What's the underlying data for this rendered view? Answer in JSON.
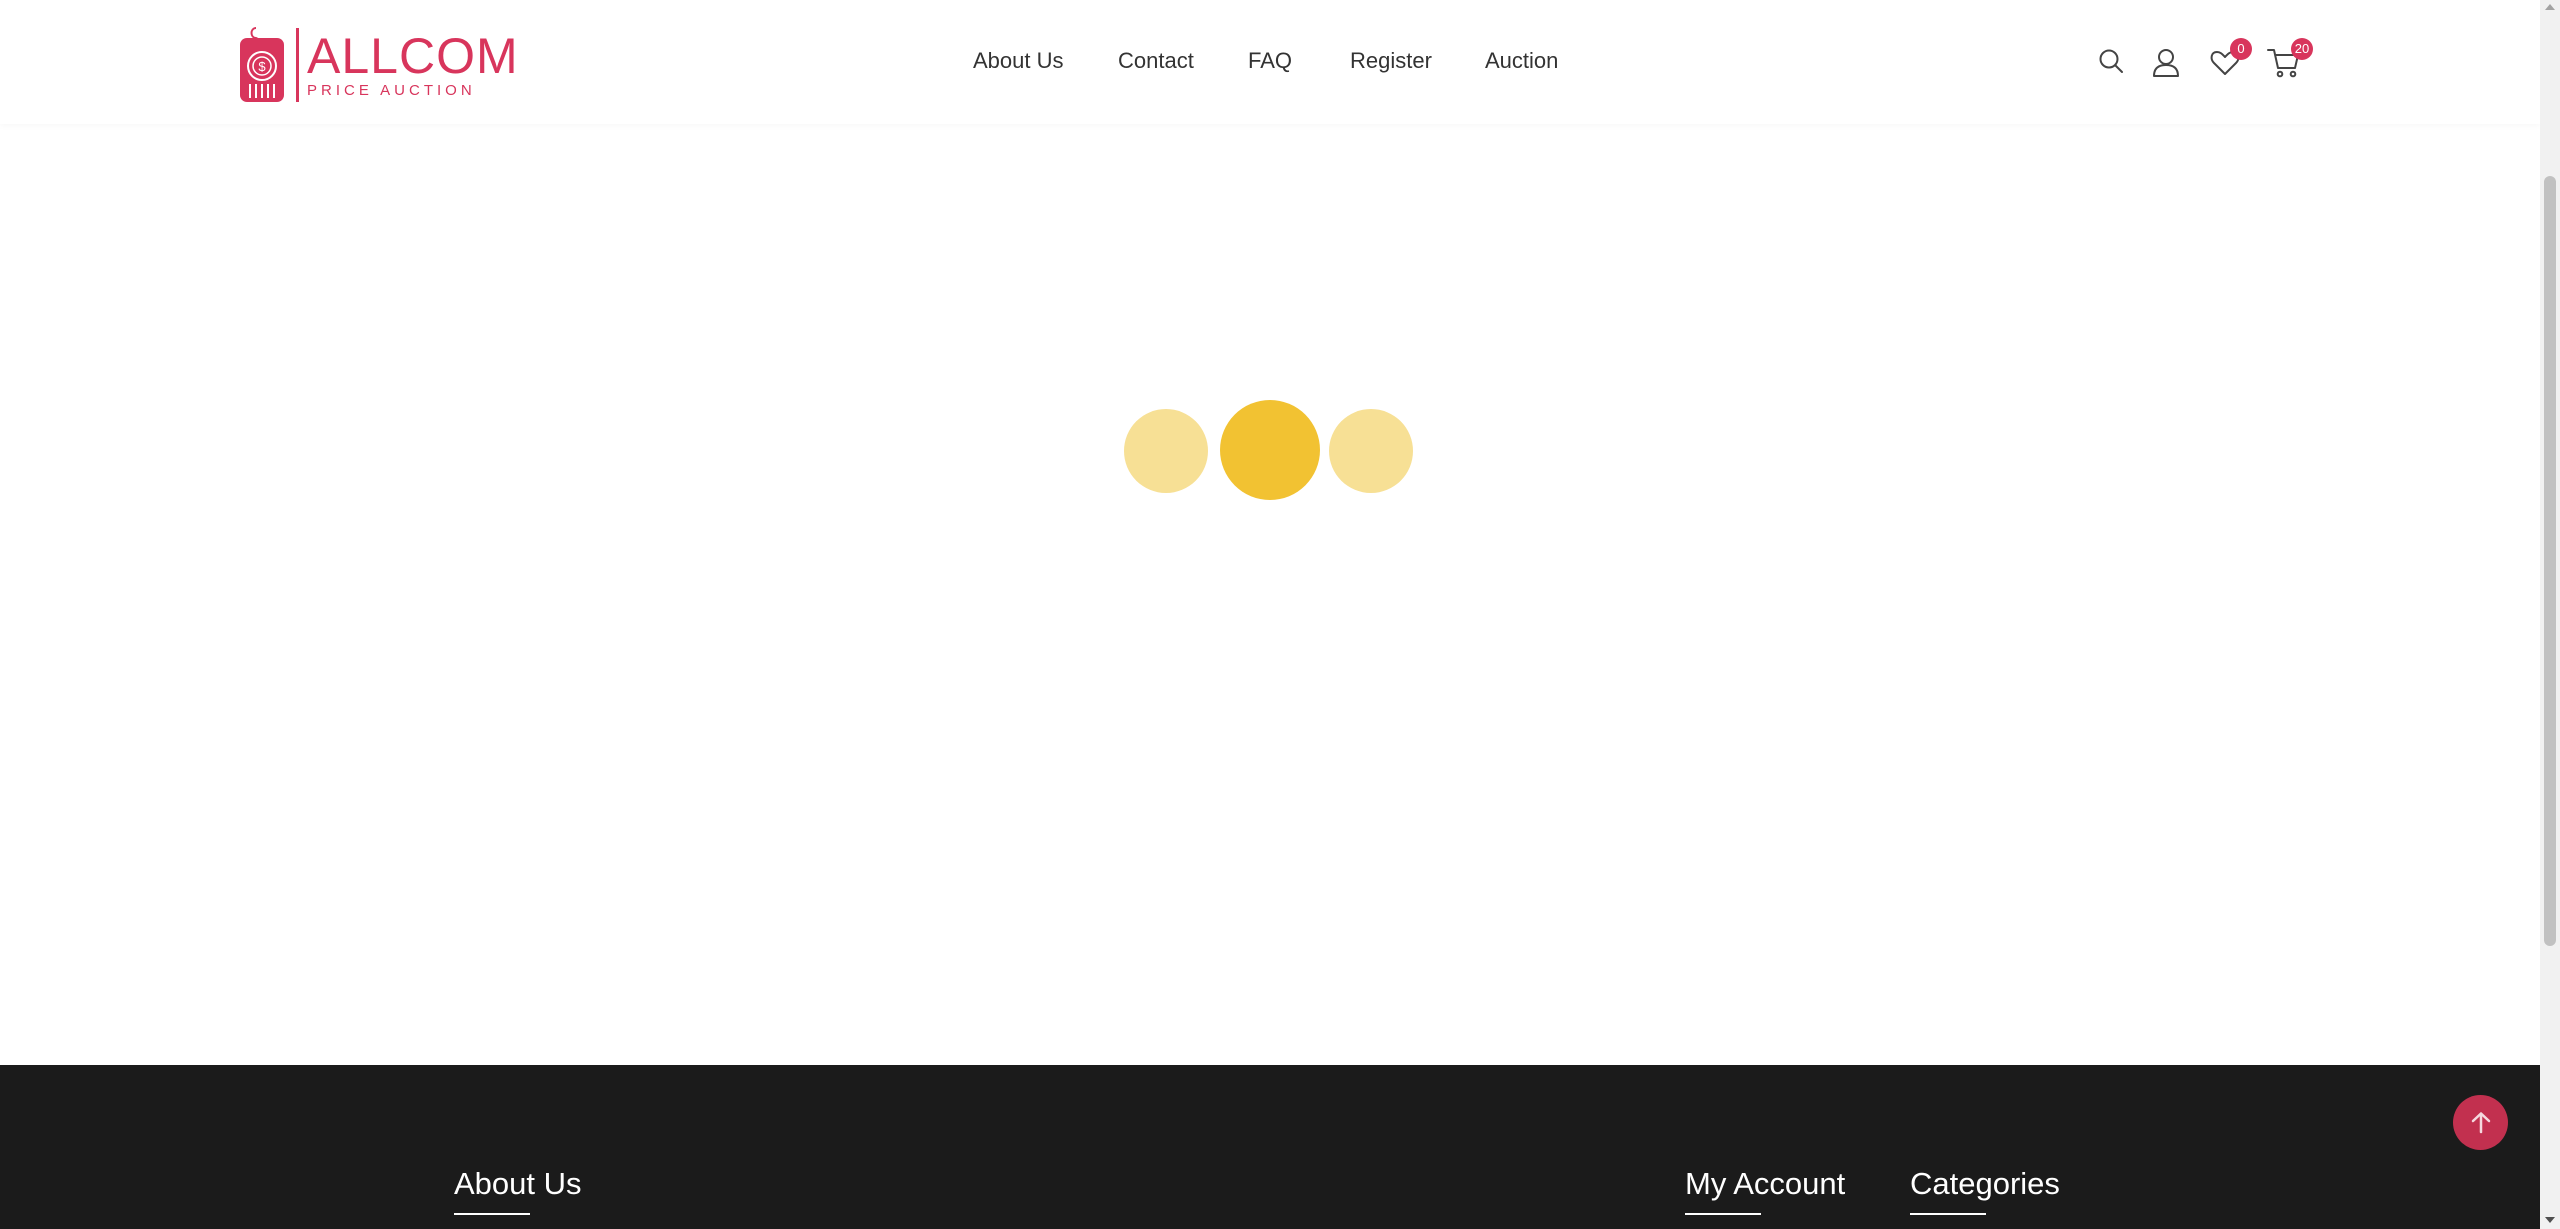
{
  "brand": {
    "name": "ALLCOM",
    "tagline": "PRICE AUCTION",
    "color": "#d8355c"
  },
  "nav": {
    "items": [
      {
        "label": "About Us"
      },
      {
        "label": "Contact"
      },
      {
        "label": "FAQ"
      },
      {
        "label": "Register"
      },
      {
        "label": "Auction"
      }
    ]
  },
  "header_icons": {
    "search": "search-icon",
    "account": "user-icon",
    "wishlist": {
      "icon": "heart-icon",
      "count": "0"
    },
    "cart": {
      "icon": "cart-icon",
      "count": "20"
    }
  },
  "loader": {
    "colors": {
      "light": "#f7e095",
      "strong": "#f2c232"
    }
  },
  "footer": {
    "columns": [
      {
        "title": "About Us"
      },
      {
        "title": "My Account"
      },
      {
        "title": "Categories"
      }
    ]
  },
  "back_to_top": {
    "icon": "arrow-up-icon",
    "color": "#c2304f"
  }
}
